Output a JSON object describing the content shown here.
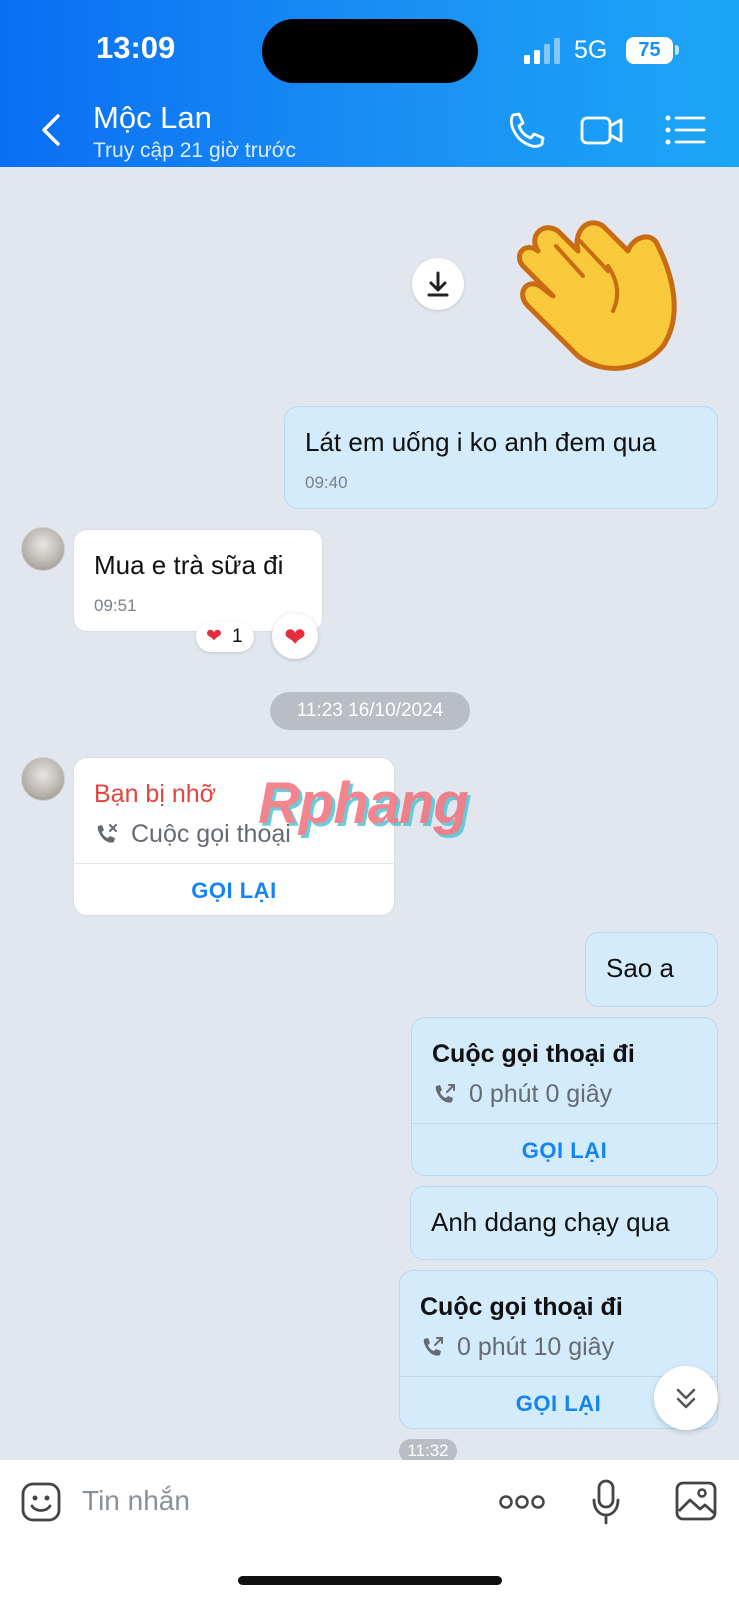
{
  "status_bar": {
    "time": "13:09",
    "network": "5G",
    "battery": "75"
  },
  "header": {
    "contact_name": "Mộc Lan",
    "last_seen": "Truy cập 21 giờ trước"
  },
  "messages": {
    "m1": {
      "text": "Lát em uống i ko anh đem qua",
      "time": "09:40"
    },
    "m2": {
      "text": "Mua e trà sữa đi",
      "time": "09:51",
      "reaction_count": "1"
    },
    "date_separator": "11:23 16/10/2024",
    "missed_call": {
      "title": "Bạn bị nhỡ",
      "subtitle": "Cuộc gọi thoại",
      "action": "GỌI LẠI"
    },
    "m3": {
      "text": "Sao a"
    },
    "call1": {
      "title": "Cuộc gọi thoại đi",
      "duration": "0 phút 0 giây",
      "action": "GỌI LẠI"
    },
    "m4": {
      "text": "Anh ddang chạy qua"
    },
    "call2": {
      "title": "Cuộc gọi thoại đi",
      "duration": "0 phút 10 giây",
      "action": "GỌI LẠI"
    },
    "last_time": "11:32"
  },
  "watermark": "Rphang",
  "composer": {
    "placeholder": "Tin nhắn"
  },
  "colors": {
    "header": "#0a6ef2",
    "outgoing_bubble": "#d3ebfb",
    "missed_call": "#e8433e",
    "action": "#1485f0"
  }
}
